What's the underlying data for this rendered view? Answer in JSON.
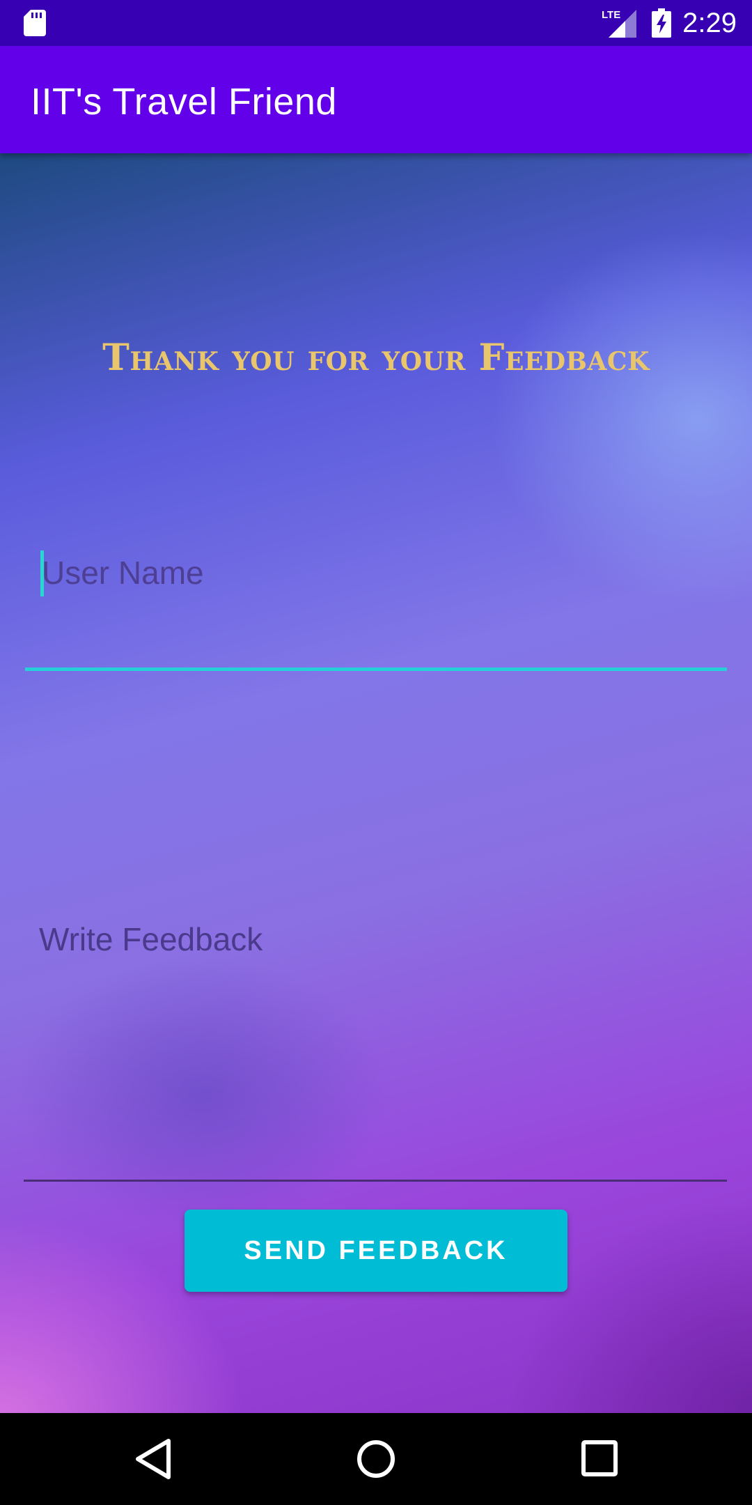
{
  "status_bar": {
    "time": "2:29",
    "network": "LTE",
    "icons": [
      "sd-card-icon",
      "lte-signal-icon",
      "battery-charging-icon"
    ]
  },
  "app_bar": {
    "title": "IIT's Travel Friend"
  },
  "main": {
    "headline": "Thank you for your Feedback",
    "username_field": {
      "placeholder": "User Name",
      "value": ""
    },
    "feedback_field": {
      "placeholder": "Write Feedback",
      "value": ""
    },
    "send_button_label": "SEND FEEDBACK"
  },
  "nav_bar": {
    "icons": [
      "back-icon",
      "home-icon",
      "recents-icon"
    ]
  },
  "colors": {
    "status_bar": "#3700b3",
    "app_bar": "#6200ea",
    "headline": "#e9c66b",
    "accent": "#26d0d8",
    "button": "#00bcd4"
  }
}
